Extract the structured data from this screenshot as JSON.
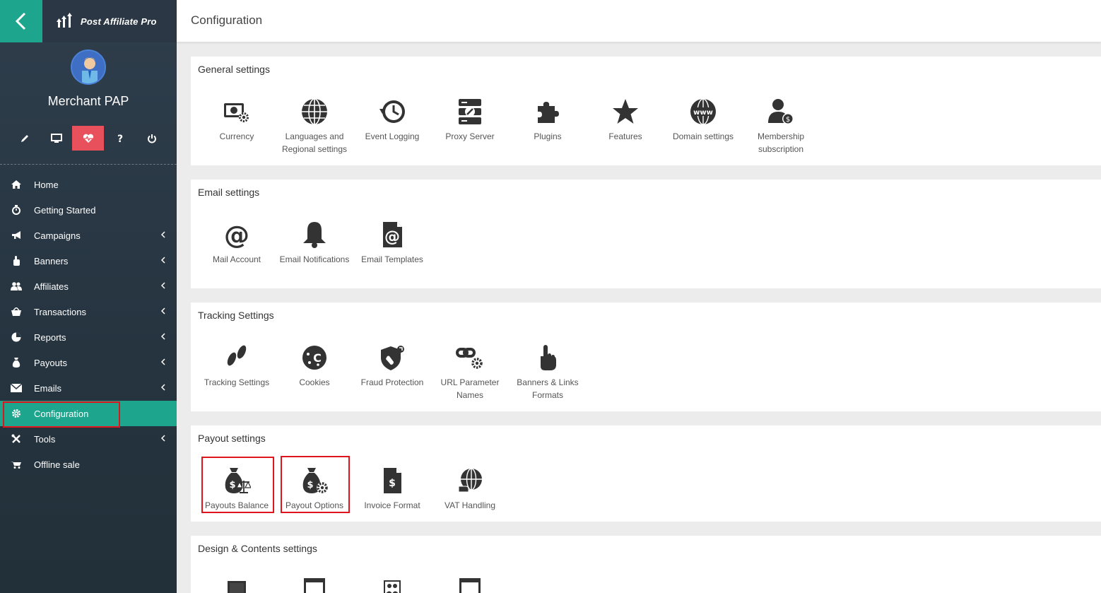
{
  "brand": {
    "name": "Post Affiliate Pro"
  },
  "user": {
    "name": "Merchant PAP"
  },
  "toolbar": [
    {
      "name": "edit-icon"
    },
    {
      "name": "monitor-icon"
    },
    {
      "name": "heart-pulse-icon"
    },
    {
      "name": "help-icon"
    },
    {
      "name": "power-icon"
    }
  ],
  "nav": [
    {
      "label": "Home",
      "icon": "home-icon"
    },
    {
      "label": "Getting Started",
      "icon": "stopwatch-icon"
    },
    {
      "label": "Campaigns",
      "icon": "megaphone-icon"
    },
    {
      "label": "Banners",
      "icon": "hand-pointer-icon"
    },
    {
      "label": "Affiliates",
      "icon": "users-icon"
    },
    {
      "label": "Transactions",
      "icon": "basket-icon"
    },
    {
      "label": "Reports",
      "icon": "pie-chart-icon"
    },
    {
      "label": "Payouts",
      "icon": "money-bag-icon"
    },
    {
      "label": "Emails",
      "icon": "envelope-icon"
    },
    {
      "label": "Configuration",
      "icon": "gear-icon"
    },
    {
      "label": "Tools",
      "icon": "tools-icon"
    },
    {
      "label": "Offline sale",
      "icon": "cart-icon"
    }
  ],
  "header": {
    "title": "Configuration"
  },
  "sections": {
    "general": {
      "title": "General settings",
      "items": [
        {
          "label": "Currency",
          "icon": "currency-gear-icon"
        },
        {
          "label": "Languages and Regional settings",
          "icon": "globe-icon"
        },
        {
          "label": "Event Logging",
          "icon": "history-clock-icon"
        },
        {
          "label": "Proxy Server",
          "icon": "server-icon"
        },
        {
          "label": "Plugins",
          "icon": "puzzle-icon"
        },
        {
          "label": "Features",
          "icon": "star-icon"
        },
        {
          "label": "Domain settings",
          "icon": "www-globe-icon"
        },
        {
          "label": "Membership subscription",
          "icon": "user-dollar-icon"
        }
      ]
    },
    "email": {
      "title": "Email settings",
      "items": [
        {
          "label": "Mail Account",
          "icon": "at-sign-icon"
        },
        {
          "label": "Email Notifications",
          "icon": "bell-icon"
        },
        {
          "label": "Email Templates",
          "icon": "email-template-icon"
        }
      ]
    },
    "tracking": {
      "title": "Tracking Settings",
      "items": [
        {
          "label": "Tracking Settings",
          "icon": "footprints-icon"
        },
        {
          "label": "Cookies",
          "icon": "cookie-icon"
        },
        {
          "label": "Fraud Protection",
          "icon": "shield-icon"
        },
        {
          "label": "URL Parameter Names",
          "icon": "link-gear-icon"
        },
        {
          "label": "Banners & Links Formats",
          "icon": "pointer-hand-icon"
        }
      ]
    },
    "payout": {
      "title": "Payout settings",
      "items": [
        {
          "label": "Payouts Balance",
          "icon": "money-bag-scales-icon"
        },
        {
          "label": "Payout Options",
          "icon": "money-bag-gear-icon"
        },
        {
          "label": "Invoice Format",
          "icon": "invoice-icon"
        },
        {
          "label": "VAT Handling",
          "icon": "globe-hand-icon"
        }
      ]
    },
    "design": {
      "title": "Design & Contents settings",
      "items": [
        {
          "icon": "template-icon"
        },
        {
          "icon": "layout-icon"
        },
        {
          "icon": "image-users-icon"
        },
        {
          "icon": "layout-icon"
        }
      ]
    }
  }
}
